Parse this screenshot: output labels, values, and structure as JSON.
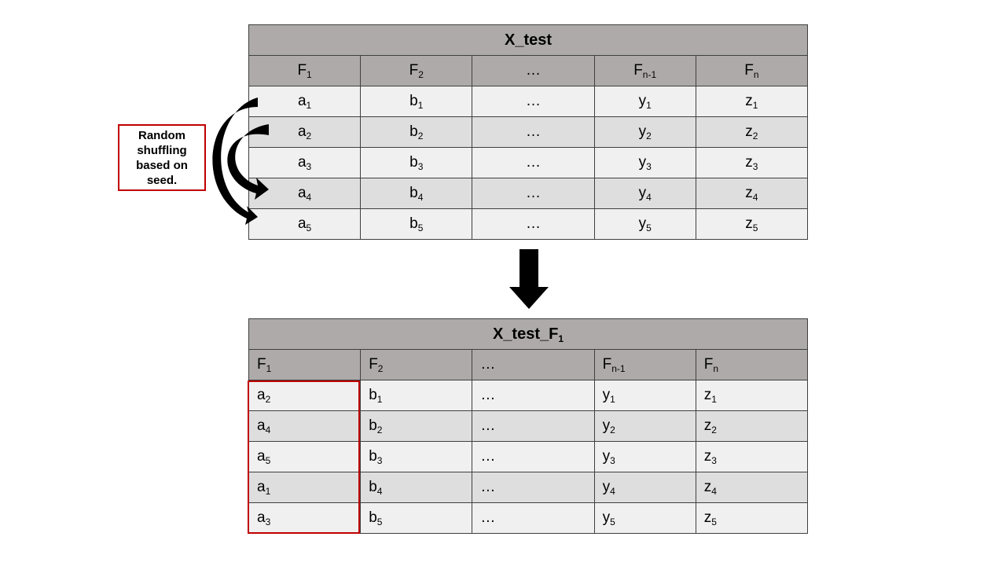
{
  "top_table": {
    "title": "X_test",
    "headers": [
      {
        "base": "F",
        "sub": "1"
      },
      {
        "base": "F",
        "sub": "2"
      },
      {
        "base": "…",
        "sub": ""
      },
      {
        "base": "F",
        "sub": "n-1"
      },
      {
        "base": "F",
        "sub": "n"
      }
    ],
    "rows": [
      [
        {
          "base": "a",
          "sub": "1"
        },
        {
          "base": "b",
          "sub": "1"
        },
        {
          "base": "…",
          "sub": ""
        },
        {
          "base": "y",
          "sub": "1"
        },
        {
          "base": "z",
          "sub": "1"
        }
      ],
      [
        {
          "base": "a",
          "sub": "2"
        },
        {
          "base": "b",
          "sub": "2"
        },
        {
          "base": "…",
          "sub": ""
        },
        {
          "base": "y",
          "sub": "2"
        },
        {
          "base": "z",
          "sub": "2"
        }
      ],
      [
        {
          "base": "a",
          "sub": "3"
        },
        {
          "base": "b",
          "sub": "3"
        },
        {
          "base": "…",
          "sub": ""
        },
        {
          "base": "y",
          "sub": "3"
        },
        {
          "base": "z",
          "sub": "3"
        }
      ],
      [
        {
          "base": "a",
          "sub": "4"
        },
        {
          "base": "b",
          "sub": "4"
        },
        {
          "base": "…",
          "sub": ""
        },
        {
          "base": "y",
          "sub": "4"
        },
        {
          "base": "z",
          "sub": "4"
        }
      ],
      [
        {
          "base": "a",
          "sub": "5"
        },
        {
          "base": "b",
          "sub": "5"
        },
        {
          "base": "…",
          "sub": ""
        },
        {
          "base": "y",
          "sub": "5"
        },
        {
          "base": "z",
          "sub": "5"
        }
      ]
    ]
  },
  "bottom_table": {
    "title": {
      "base": "X_test_F",
      "sub": "1"
    },
    "headers": [
      {
        "base": "F",
        "sub": "1"
      },
      {
        "base": "F",
        "sub": "2"
      },
      {
        "base": "…",
        "sub": ""
      },
      {
        "base": "F",
        "sub": "n-1"
      },
      {
        "base": "F",
        "sub": "n"
      }
    ],
    "rows": [
      [
        {
          "base": "a",
          "sub": "2"
        },
        {
          "base": "b",
          "sub": "1"
        },
        {
          "base": "…",
          "sub": ""
        },
        {
          "base": "y",
          "sub": "1"
        },
        {
          "base": "z",
          "sub": "1"
        }
      ],
      [
        {
          "base": "a",
          "sub": "4"
        },
        {
          "base": "b",
          "sub": "2"
        },
        {
          "base": "…",
          "sub": ""
        },
        {
          "base": "y",
          "sub": "2"
        },
        {
          "base": "z",
          "sub": "2"
        }
      ],
      [
        {
          "base": "a",
          "sub": "5"
        },
        {
          "base": "b",
          "sub": "3"
        },
        {
          "base": "…",
          "sub": ""
        },
        {
          "base": "y",
          "sub": "3"
        },
        {
          "base": "z",
          "sub": "3"
        }
      ],
      [
        {
          "base": "a",
          "sub": "1"
        },
        {
          "base": "b",
          "sub": "4"
        },
        {
          "base": "…",
          "sub": ""
        },
        {
          "base": "y",
          "sub": "4"
        },
        {
          "base": "z",
          "sub": "4"
        }
      ],
      [
        {
          "base": "a",
          "sub": "3"
        },
        {
          "base": "b",
          "sub": "5"
        },
        {
          "base": "…",
          "sub": ""
        },
        {
          "base": "y",
          "sub": "5"
        },
        {
          "base": "z",
          "sub": "5"
        }
      ]
    ]
  },
  "note": {
    "lines": [
      "Random",
      "shuffling",
      "based on",
      "seed."
    ]
  },
  "colors": {
    "header_fill": "#aeaaaa",
    "row_light": "#f0f0f0",
    "row_dark": "#dedede",
    "highlight_border": "#c00000",
    "arrow_fill": "#000000"
  },
  "icons": {
    "shuffle_arrows": "curved-arrow-icon",
    "transform_arrow": "arrow-down-icon"
  }
}
